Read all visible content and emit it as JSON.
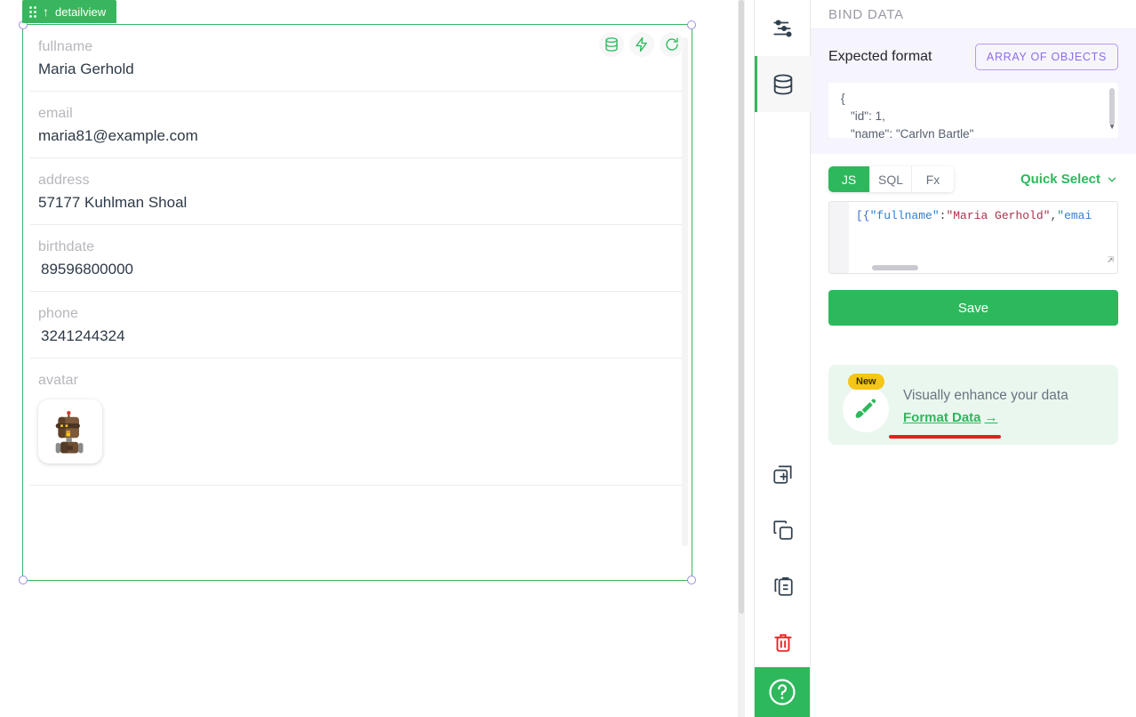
{
  "canvas": {
    "widget": {
      "label": "detailview",
      "drag_handle_icon": "drag-dots-icon",
      "collapse_icon": "arrow-up-icon",
      "tools": [
        {
          "name": "database-icon",
          "title": "Data"
        },
        {
          "name": "lightning-icon",
          "title": "Actions"
        },
        {
          "name": "refresh-icon",
          "title": "Refresh"
        }
      ],
      "fields": [
        {
          "label": "fullname",
          "value": "Maria Gerhold"
        },
        {
          "label": "email",
          "value": "maria81@example.com"
        },
        {
          "label": "address",
          "value": "57177 Kuhlman Shoal"
        },
        {
          "label": "birthdate",
          "value": "89596800000"
        },
        {
          "label": "phone",
          "value": "3241244324"
        }
      ],
      "avatar_field": {
        "label": "avatar",
        "image_alt": "robot-avatar"
      }
    }
  },
  "icon_strip": {
    "items": [
      {
        "name": "sliders-icon",
        "label": "Properties",
        "active": false
      },
      {
        "name": "database-icon",
        "label": "Bind Data",
        "active": true
      },
      {
        "name": "duplicate-icon",
        "label": "Duplicate",
        "active": false
      },
      {
        "name": "copy-icon",
        "label": "Copy",
        "active": false
      },
      {
        "name": "paste-icon",
        "label": "Paste",
        "active": false
      },
      {
        "name": "trash-icon",
        "label": "Delete",
        "active": false
      }
    ],
    "help_button": {
      "name": "help-icon",
      "label": "?"
    }
  },
  "right_panel": {
    "header_title": "BIND DATA",
    "expected_format": {
      "label": "Expected format",
      "badge": "ARRAY OF OBJECTS",
      "preview_lines": [
        "{",
        "\"id\": 1,",
        "\"name\": \"Carlyn Bartle\""
      ]
    },
    "editor": {
      "tabs": [
        {
          "label": "JS",
          "active": true
        },
        {
          "label": "SQL",
          "active": false
        },
        {
          "label": "Fx",
          "active": false
        }
      ],
      "quick_select": {
        "label": "Quick Select",
        "chevron": "chevron-down-icon"
      },
      "code_tokens": [
        {
          "t": "[{",
          "c": "tk-br"
        },
        {
          "t": "\"fullname\"",
          "c": "tk-key"
        },
        {
          "t": ":",
          "c": "tk-pun"
        },
        {
          "t": "\"Maria Gerhold\"",
          "c": "tk-str"
        },
        {
          "t": ",",
          "c": "tk-pun"
        },
        {
          "t": "\"emai",
          "c": "tk-key"
        }
      ],
      "code_plain": "[{\"fullname\":\"Maria Gerhold\",\"emai"
    },
    "save_button": "Save",
    "promo": {
      "badge": "New",
      "icon": "paintbrush-icon",
      "title": "Visually enhance your data",
      "link": "Format Data",
      "link_arrow": "→"
    }
  },
  "colors": {
    "green": "#2eb85c",
    "green_border": "#39b65d",
    "purple": "#8c6ee8",
    "red": "#e81c1c",
    "yellow": "#f5c518",
    "label_gray": "#b6b6bd"
  }
}
